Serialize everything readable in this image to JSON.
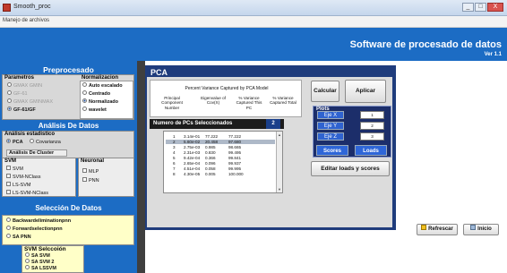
{
  "window": {
    "title": "Smooth_proc",
    "controls": [
      "_",
      "□",
      "X"
    ]
  },
  "menu": {
    "item": "Manejo de archivos"
  },
  "banner": {
    "title": "Software de procesado de datos",
    "version": "Ver 1.1"
  },
  "preprocesado": {
    "header": "Preprocesado",
    "parametros_title": "Parametros",
    "parametros": [
      "GMAX GMIN",
      "GF-61",
      "GMAX GMINMAX",
      "GF-61/GF"
    ],
    "parametros_selected": 3,
    "normalizacion_title": "Normalizacion",
    "normalizacion": [
      "Auto escalado",
      "Centrado",
      "Normalizado",
      "wavelet"
    ],
    "normalizacion_selected": 2
  },
  "analisis": {
    "header": "Análisis De Datos",
    "estadistico_title": "Análisis estadistico",
    "estadistico": [
      "PCA",
      "Covarianza"
    ],
    "cluster": "Análisis De Cluster",
    "svm_title": "SVM",
    "svm": [
      "SVM",
      "SVM-NClass",
      "LS-SVM",
      "LS-SVM-NClass"
    ],
    "neuronal_title": "Neuronal",
    "neuronal": [
      "MLP",
      "PNN"
    ]
  },
  "seleccion": {
    "header": "Selección  De Datos",
    "items": [
      "Backwardeliminationpnn",
      "Forwardselectionpnn",
      "SA PNN"
    ],
    "svm_title": "SVM Selccoión",
    "svm_items": [
      "SA SVM",
      "SA SVM 2",
      "SA LSSVM"
    ]
  },
  "pca": {
    "title": "PCA",
    "variance_title": "Percent Variance Captured by PCA Model",
    "headers": {
      "component": "Principal Component Number",
      "eigen": "Eigenvalue of Cov(X)",
      "this_pc": "% Variance Captured This PC",
      "total": "% Variance Captured Total"
    },
    "num_label": "Numero de PCs Seleccionados",
    "num_value": "2",
    "rows": [
      [
        "1",
        "3.14e-01",
        "77.222",
        "77.222"
      ],
      [
        "2",
        "5.60e-02",
        "20.458",
        "97.680"
      ],
      [
        "3",
        "2.75e-03",
        "0.985",
        "98.665"
      ],
      [
        "4",
        "2.31e-03",
        "0.830",
        "99.495"
      ],
      [
        "5",
        "9.42e-04",
        "0.366",
        "99.841"
      ],
      [
        "6",
        "2.65e-04",
        "0.096",
        "99.937"
      ],
      [
        "7",
        "4.51e-04",
        "0.058",
        "99.995"
      ],
      [
        "8",
        "4.30e-05",
        "0.005",
        "100.000"
      ]
    ],
    "selected_row": 1,
    "calcular": "Calcular",
    "aplicar": "Aplicar",
    "plots_title": "Plots",
    "ejes": [
      {
        "label": "Eje X",
        "value": "1"
      },
      {
        "label": "Eje Y",
        "value": "2"
      },
      {
        "label": "Eje Z",
        "value": "3"
      }
    ],
    "scores": "Scores",
    "loads": "Loads",
    "editar": "Editar loads y scores"
  },
  "footer": {
    "refrescar": "Refrescar",
    "inicio": "Inicio"
  },
  "colors": {
    "banner": "#1c6cc4",
    "panel": "#1f3c7c",
    "button_blue": "#2e66d8"
  }
}
